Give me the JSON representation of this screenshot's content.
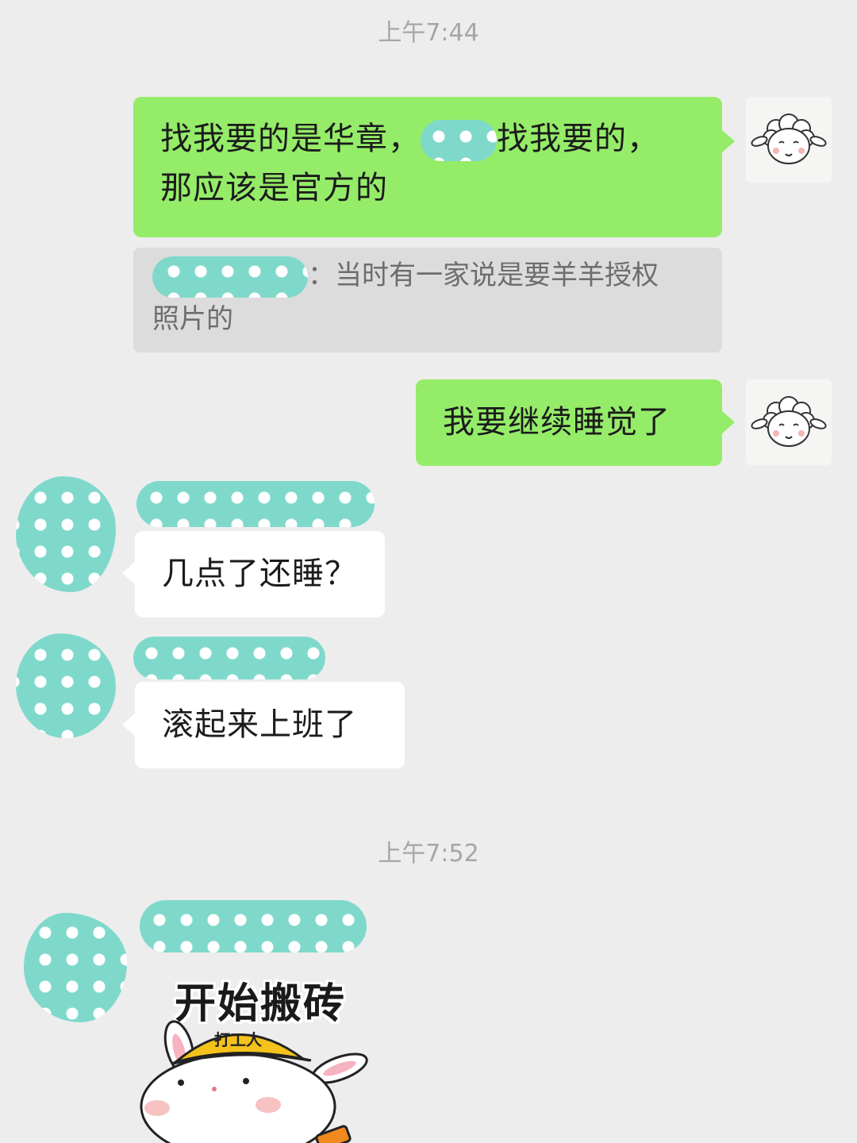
{
  "timestamps": [
    "上午7:44",
    "上午7:52"
  ],
  "messages": {
    "m1_line1": "找我要的是华章，",
    "m1_line1b": "找我要的，",
    "m1_line2": "那应该是官方的",
    "quote_text": "：当时有一家说是要羊羊授权",
    "quote_line2": "照片的",
    "m2": "我要继续睡觉了",
    "m3": "几点了还睡？",
    "m4": "滚起来上班了"
  },
  "sticker": {
    "title": "开始搬砖",
    "hat_text": "打工人"
  },
  "colors": {
    "background": "#ededed",
    "bubble_self": "#95ec69",
    "bubble_other": "#ffffff",
    "redaction": "#7fd9cb"
  },
  "icons": {
    "self_avatar": "sheep-icon",
    "sticker": "bunny-worker-sticker"
  }
}
